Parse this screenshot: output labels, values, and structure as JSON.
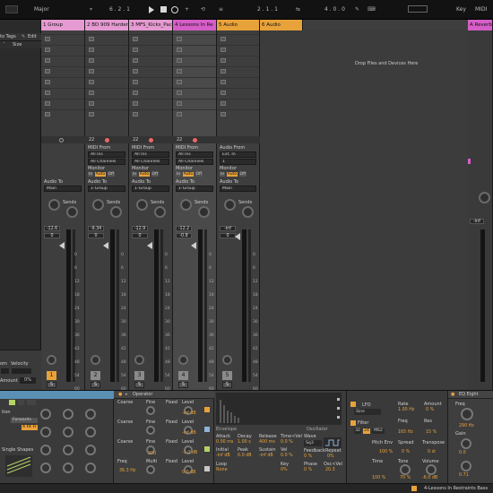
{
  "transport": {
    "scale_label": "Major",
    "arrangement_position": "6 . 2 . 1",
    "loop_start": "2 . 1 . 1",
    "loop_length": "4 . 0 . 0",
    "key_label": "Key",
    "midi_label": "MIDI",
    "percent": "%"
  },
  "browser": {
    "add_to_tags": "to Tags",
    "edit": "Edit",
    "size_col": "Size"
  },
  "tracks": [
    {
      "name": "1 Group",
      "color": "#e59ad1",
      "number": "1",
      "armed": true,
      "volume": "-12.6",
      "pan": "0"
    },
    {
      "name": "2 BD 909 Harder",
      "color": "#e59ad1",
      "number": "2",
      "armed": false,
      "volume": "-9.34",
      "pan": "0"
    },
    {
      "name": "3 MFS_Kicks_Pac",
      "color": "#e59ad1",
      "number": "3",
      "armed": false,
      "volume": "-12.9",
      "pan": "0"
    },
    {
      "name": "4 Lessons In Re",
      "color": "#d65ec8",
      "number": "4",
      "armed": false,
      "volume": "-12.2",
      "pan": "-0.8"
    },
    {
      "name": "5 Audio",
      "color": "#e8a23a",
      "number": "5",
      "armed": false,
      "volume": "-inf",
      "pan": "0"
    },
    {
      "name": "6 Audio",
      "color": "#e8a23a",
      "number": "6",
      "armed": false,
      "volume": "-inf",
      "pan": "0"
    }
  ],
  "return_track": {
    "name": "A Reverb",
    "color": "#d65ec8"
  },
  "io": {
    "midi_from": "MIDI From",
    "audio_from": "Audio From",
    "all_ins": "All Ins",
    "all_channels": "All Channels",
    "ext_in": "Ext. In",
    "input_1": "1",
    "monitor": "Monitor",
    "in": "In",
    "auto": "Auto",
    "off": "Off",
    "audio_to": "Audio To",
    "main": "Main",
    "group": "1-Group",
    "sends": "Sends",
    "slot_numbers": [
      "22",
      "22",
      "22"
    ]
  },
  "mixer": {
    "db_ticks": [
      "0",
      "6",
      "12",
      "18",
      "24",
      "30",
      "36",
      "42",
      "48",
      "54",
      "60"
    ],
    "drop_text": "Drop Files and Devices Here",
    "inf": "-inf"
  },
  "left_panel": {
    "zoom": "om",
    "velocity": "Velocity",
    "amount": "Amount",
    "amount_val": "0%"
  },
  "devices": {
    "sampler": {
      "mode": "Forwards",
      "single_shapes": "Single Shapes",
      "filter_label": "A Fit Fr",
      "sub_lbl": "tion"
    },
    "operator": {
      "title": "Operator",
      "rows": [
        {
          "coarse": "Coarse",
          "fine": "Fine",
          "fixed": "Fixed",
          "level": "Level"
        },
        {
          "coarse": "Coarse",
          "fine": "Fine",
          "fixed": "Fixed",
          "level": "Level"
        },
        {
          "coarse": "Coarse",
          "fine": "Fine",
          "fixed": "Fixed",
          "level": "Level"
        },
        {
          "coarse": "Freq",
          "fine": "Multi",
          "fixed": "Fixed",
          "level": "Level"
        }
      ],
      "level_values": [
        "-inf dB",
        "-inf dB",
        "-1.0 dB",
        "0.0 dB"
      ],
      "fine_value": "200",
      "freq_value": "36.3 Hz"
    },
    "envelope": {
      "tab_envelope": "Envelope",
      "tab_oscillator": "Oscillator",
      "headers": [
        "Attack",
        "Decay",
        "Release",
        "Time<Vel"
      ],
      "values": [
        "0.00 ms",
        "1.00 s",
        "400 ms",
        "0.0 %"
      ],
      "headers2": [
        "Initial",
        "Peak",
        "Sustain",
        "Vel"
      ],
      "values2": [
        "-inf dB",
        "0.0 dB",
        "-inf dB",
        "0.0 %"
      ],
      "loop": "Loop",
      "loop_val": "None",
      "key": "Key",
      "key_val": "0%",
      "wave": "Wave",
      "wave_val": "Sq3",
      "feedback": "Feedback",
      "feedback_val": "0 %",
      "repeat": "Repeat",
      "repeat_val": "0%",
      "phase": "Phase",
      "phase_val": "0 %",
      "osc_vel": "Osc<Vel",
      "osc_vel_val": "20.3"
    },
    "lfo": {
      "title": "LFO",
      "shape": "Sine",
      "rate": "Rate",
      "rate_val": "1.00 Hz",
      "amount": "Amount",
      "amount_val": "0 %",
      "filter": "Filter",
      "freq": "Freq",
      "freq_val": "165 Hz",
      "res": "Res",
      "res_val": "15 %",
      "ms2": "MS2",
      "vals_32": "32",
      "vals_24": "24",
      "pitch_env": "Pitch Env",
      "pitch_env_val": "100 %",
      "spread": "Spread",
      "spread_val": "0 %",
      "transpose": "Transpose",
      "transpose_val": "0 st",
      "time": "Time",
      "time_val": "100 %",
      "tone": "Tone",
      "tone_val": "70 %",
      "volume": "Volume",
      "volume_val": "-6.0 dB"
    },
    "eq": {
      "title": "EQ Eight",
      "freq": "Freq",
      "freq_val": "290 Hz",
      "gain": "Gain",
      "gain_val": "0.0",
      "q_val": "0.71"
    }
  },
  "status": {
    "clip_name": "4-Lessons In Restraints Bass"
  }
}
